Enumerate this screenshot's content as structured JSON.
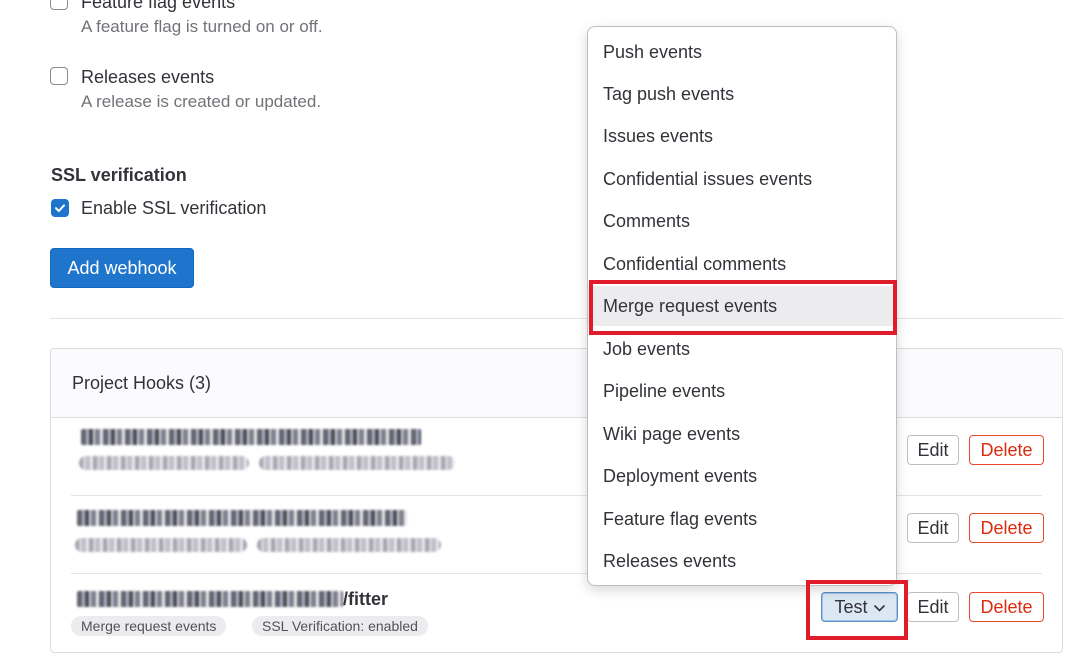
{
  "events_section": {
    "feature_flag": {
      "label": "Feature flag events",
      "help": "A feature flag is turned on or off.",
      "checked": false
    },
    "releases": {
      "label": "Releases events",
      "help": "A release is created or updated.",
      "checked": false
    }
  },
  "ssl": {
    "title": "SSL verification",
    "label": "Enable SSL verification",
    "checked": true
  },
  "add_webhook_label": "Add webhook",
  "project_hooks": {
    "title": "Project Hooks (3)",
    "hooks": [
      {
        "url_visible": "",
        "tags": [],
        "edit_label": "Edit",
        "delete_label": "Delete"
      },
      {
        "url_visible": "",
        "tags": [],
        "edit_label": "Edit",
        "delete_label": "Delete"
      },
      {
        "url_visible": "/fitter",
        "tags": [
          "Merge request events",
          "SSL Verification: enabled"
        ],
        "test_label": "Test",
        "edit_label": "Edit",
        "delete_label": "Delete"
      }
    ]
  },
  "test_dropdown": {
    "items": [
      "Push events",
      "Tag push events",
      "Issues events",
      "Confidential issues events",
      "Comments",
      "Confidential comments",
      "Merge request events",
      "Job events",
      "Pipeline events",
      "Wiki page events",
      "Deployment events",
      "Feature flag events",
      "Releases events"
    ],
    "highlighted_item": "Merge request events"
  },
  "colors": {
    "primary": "#1f75cb",
    "danger": "#dd2b0e",
    "annotation_red": "#e01b2a"
  }
}
